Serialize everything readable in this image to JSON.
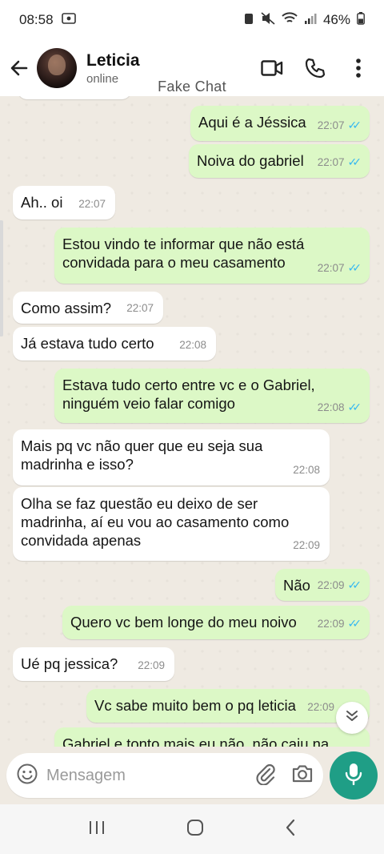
{
  "status": {
    "time": "08:58",
    "battery": "46%"
  },
  "header": {
    "name": "Leticia",
    "presence": "online",
    "watermark": "Fake Chat"
  },
  "messages": [
    {
      "dir": "out",
      "text": "Aqui é a Jéssica",
      "time": "22:07"
    },
    {
      "dir": "out",
      "text": "Noiva do gabriel",
      "time": "22:07"
    },
    {
      "dir": "in",
      "text": "Ah.. oi",
      "time": "22:07"
    },
    {
      "dir": "out",
      "text": "Estou vindo te informar que não está convidada para o meu casamento",
      "time": "22:07"
    },
    {
      "dir": "in",
      "text": "Como assim?",
      "time": "22:07"
    },
    {
      "dir": "in",
      "text": "Já estava tudo certo",
      "time": "22:08"
    },
    {
      "dir": "out",
      "text": "Estava tudo certo entre vc e o Gabriel, ninguém veio falar comigo",
      "time": "22:08"
    },
    {
      "dir": "in",
      "text": "Mais pq vc não quer que eu seja sua madrinha e isso?",
      "time": "22:08"
    },
    {
      "dir": "in",
      "text": "Olha se faz questão eu deixo de ser madrinha, aí eu vou ao casamento como convidada apenas",
      "time": "22:09"
    },
    {
      "dir": "out",
      "text": "Não",
      "time": "22:09"
    },
    {
      "dir": "out",
      "text": "Quero vc bem longe do meu noivo",
      "time": "22:09"
    },
    {
      "dir": "in",
      "text": "Ué pq jessica?",
      "time": "22:09"
    },
    {
      "dir": "out",
      "text": "Vc sabe muito bem o pq leticia",
      "time": "22:09"
    },
    {
      "dir": "out",
      "text": "Gabriel e tonto mais eu não, não caiu na",
      "time": ""
    }
  ],
  "composer": {
    "placeholder": "Mensagem"
  },
  "colors": {
    "outgoing_bubble": "#dcf8c6",
    "incoming_bubble": "#ffffff",
    "chat_background": "#efeae2",
    "read_ticks": "#34b7f1",
    "mic_button": "#1f9e86"
  }
}
